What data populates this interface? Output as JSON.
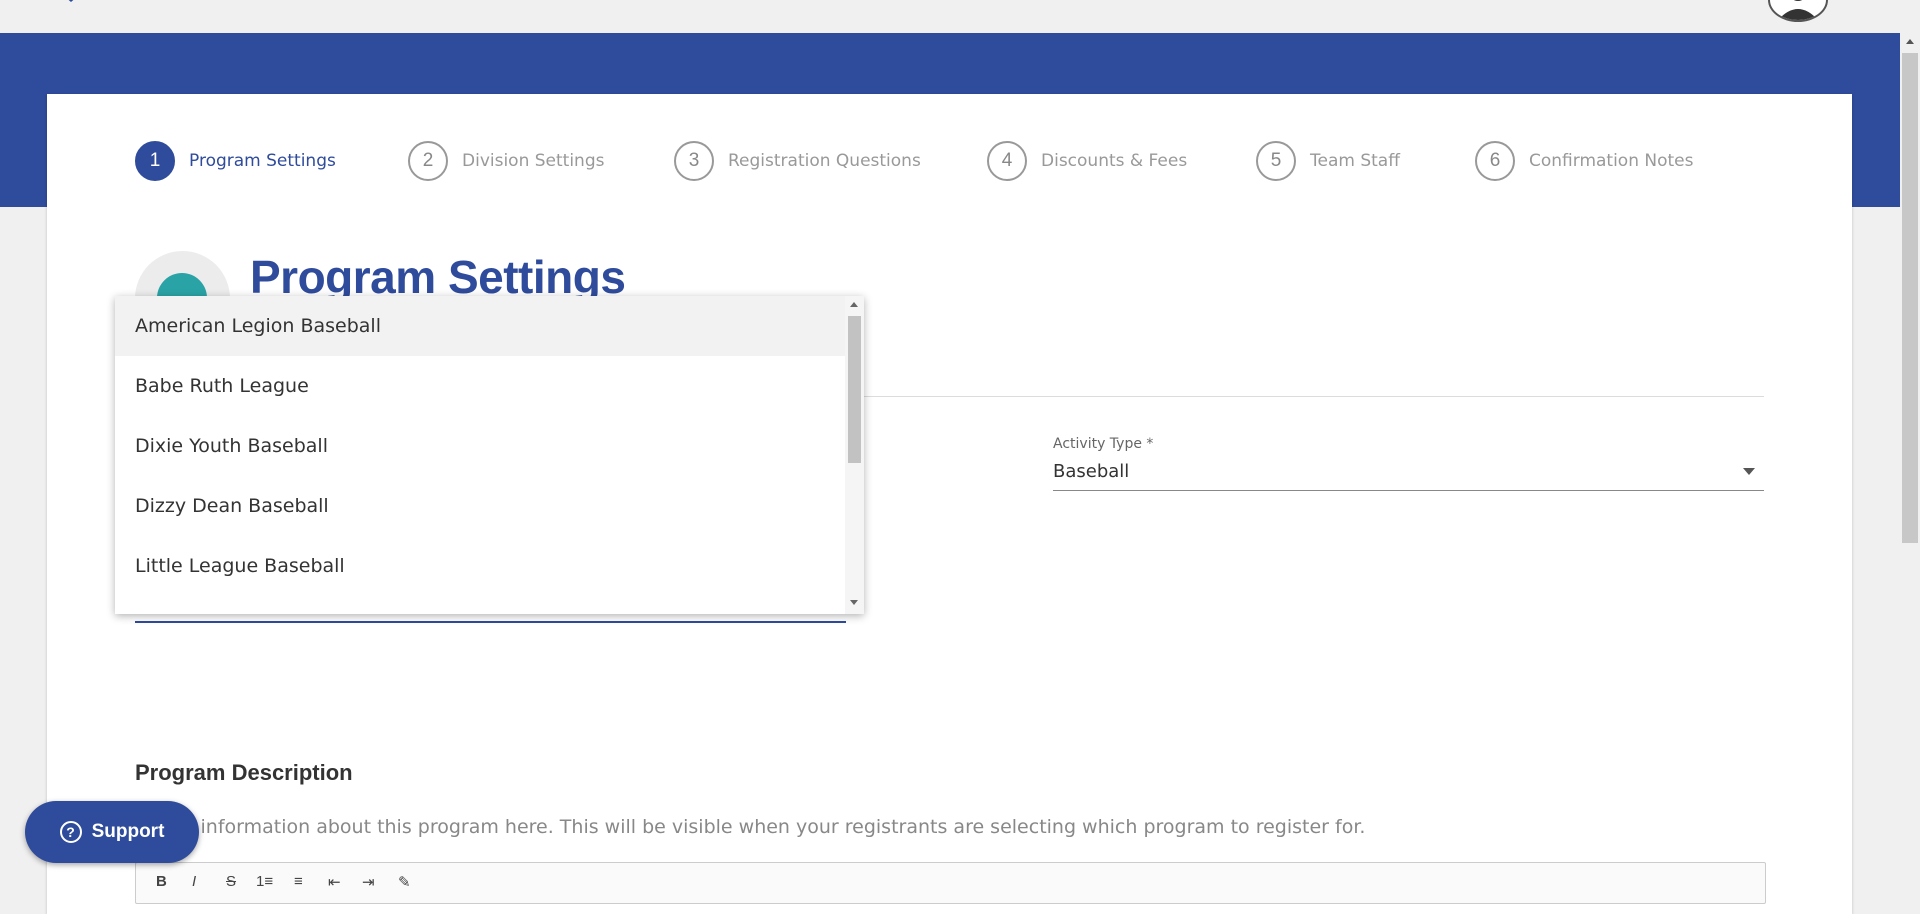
{
  "steps": [
    {
      "num": "1",
      "label": "Program Settings",
      "active": true
    },
    {
      "num": "2",
      "label": "Division Settings",
      "active": false
    },
    {
      "num": "3",
      "label": "Registration Questions",
      "active": false
    },
    {
      "num": "4",
      "label": "Discounts & Fees",
      "active": false
    },
    {
      "num": "5",
      "label": "Team Staff",
      "active": false
    },
    {
      "num": "6",
      "label": "Confirmation Notes",
      "active": false
    }
  ],
  "page": {
    "title": "Program Settings",
    "icon": "baseball-icon"
  },
  "activity_type": {
    "label": "Activity Type *",
    "value": "Baseball"
  },
  "dropdown": {
    "options": [
      "American Legion Baseball",
      "Babe Ruth League",
      "Dixie Youth Baseball",
      "Dizzy Dean Baseball",
      "Little League Baseball"
    ],
    "highlighted_index": 0
  },
  "description": {
    "title": "Program Description",
    "help_text": "...lpful information about this program here. This will be visible when your registrants are selecting which program to register for."
  },
  "editor_toolbar": [
    "B",
    "I",
    "S",
    "1≡",
    "≡",
    "⇤",
    "⇥",
    "✎"
  ],
  "support": {
    "label": "Support",
    "icon": "question-circle-icon"
  },
  "colors": {
    "brand": "#2f4b9b",
    "accent_ball": "#2aa3a6"
  }
}
